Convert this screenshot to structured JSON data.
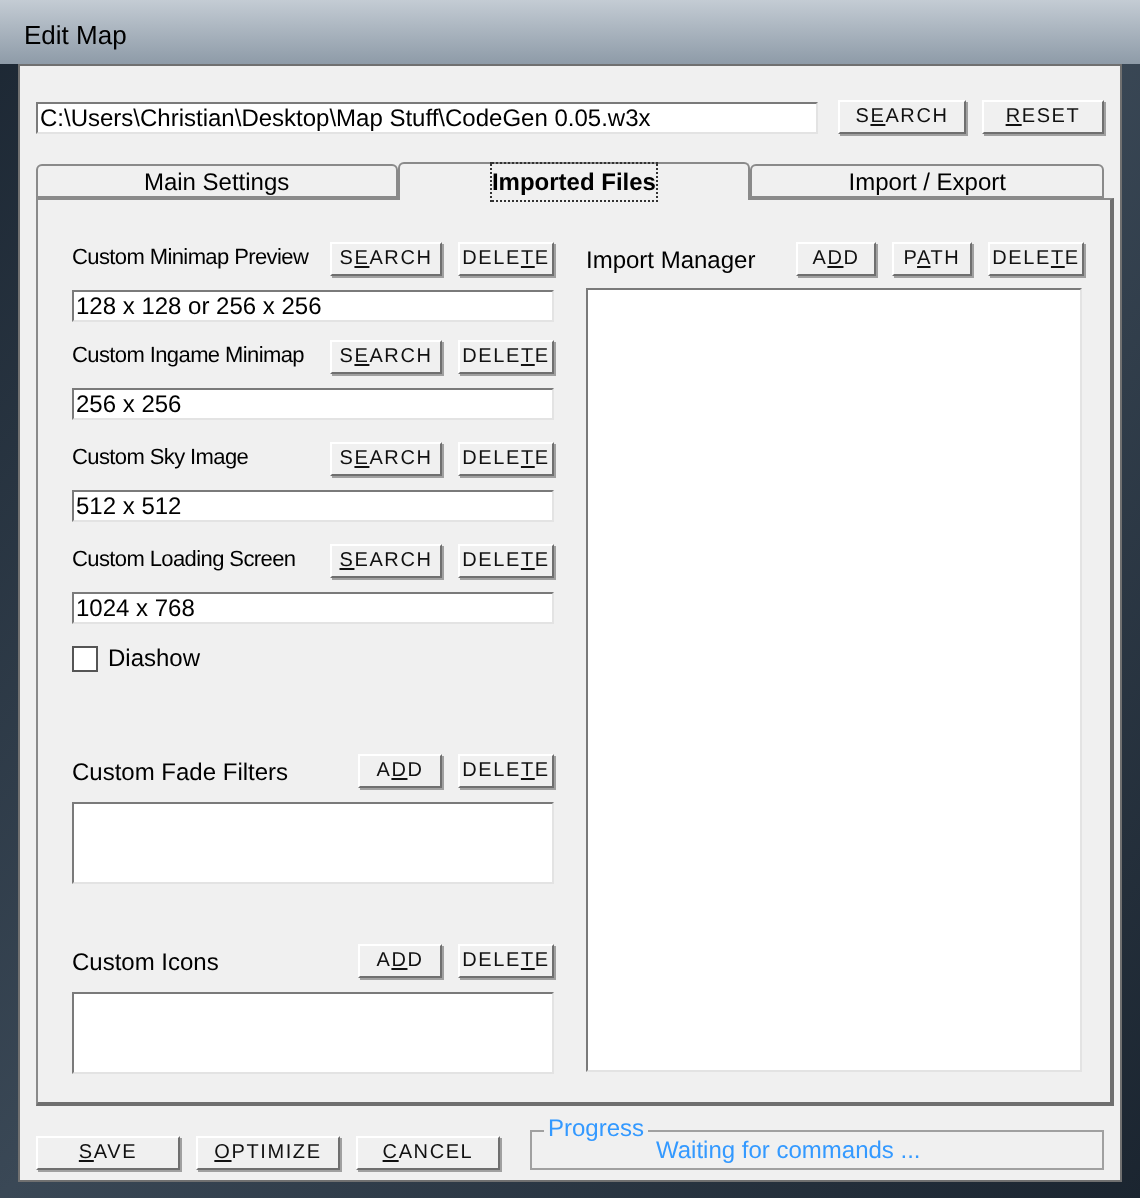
{
  "window": {
    "title": "Edit Map"
  },
  "map_path": {
    "value": "C:\\Users\\Christian\\Desktop\\Map Stuff\\CodeGen 0.05.w3x"
  },
  "top_buttons": [
    {
      "pre": "S",
      "key": "E",
      "post": "ARCH"
    },
    {
      "key": "R",
      "post": "ESET"
    }
  ],
  "tabs": [
    {
      "label": "Main Settings",
      "selected": false
    },
    {
      "label": "Imported Files",
      "selected": true
    },
    {
      "label": "Import / Export",
      "selected": false
    }
  ],
  "image_fields": [
    {
      "label": "Custom Minimap Preview",
      "value": "128 x 128 or 256 x 256",
      "buttons": [
        {
          "pre": "S",
          "key": "E",
          "post": "ARCH"
        },
        {
          "pre": "DELE",
          "key": "T",
          "post": "E"
        }
      ]
    },
    {
      "label": "Custom Ingame Minimap",
      "value": "256 x 256",
      "buttons": [
        {
          "pre": "S",
          "key": "E",
          "post": "ARCH"
        },
        {
          "pre": "DELE",
          "key": "T",
          "post": "E"
        }
      ]
    },
    {
      "label": "Custom Sky Image",
      "value": "512 x 512",
      "buttons": [
        {
          "pre": "S",
          "key": "E",
          "post": "ARCH"
        },
        {
          "pre": "DELE",
          "key": "T",
          "post": "E"
        }
      ]
    },
    {
      "label": "Custom Loading Screen",
      "value": "1024 x 768",
      "buttons": [
        {
          "key": "S",
          "post": "EARCH"
        },
        {
          "pre": "DELE",
          "key": "T",
          "post": "E"
        }
      ]
    }
  ],
  "slideshow": {
    "label": "Diashow",
    "checked": false
  },
  "lists": [
    {
      "label": "Custom Fade Filters",
      "buttons": [
        {
          "pre": "A",
          "key": "D",
          "post": "D"
        },
        {
          "pre": "DELE",
          "key": "T",
          "post": "E"
        }
      ]
    },
    {
      "label": "Custom Icons",
      "buttons": [
        {
          "pre": "A",
          "key": "D",
          "post": "D"
        },
        {
          "pre": "DELE",
          "key": "T",
          "post": "E"
        }
      ]
    }
  ],
  "import_manager": {
    "label": "Import Manager",
    "buttons": [
      {
        "pre": "A",
        "key": "D",
        "post": "D"
      },
      {
        "pre": "P",
        "key": "A",
        "post": "TH"
      },
      {
        "pre": "DELE",
        "key": "T",
        "post": "E"
      }
    ]
  },
  "bottom_buttons": [
    {
      "key": "S",
      "post": "AVE"
    },
    {
      "key": "O",
      "post": "PTIMIZE"
    },
    {
      "key": "C",
      "post": "ANCEL"
    }
  ],
  "progress": {
    "legend": "Progress",
    "status": "Waiting for commands ..."
  }
}
